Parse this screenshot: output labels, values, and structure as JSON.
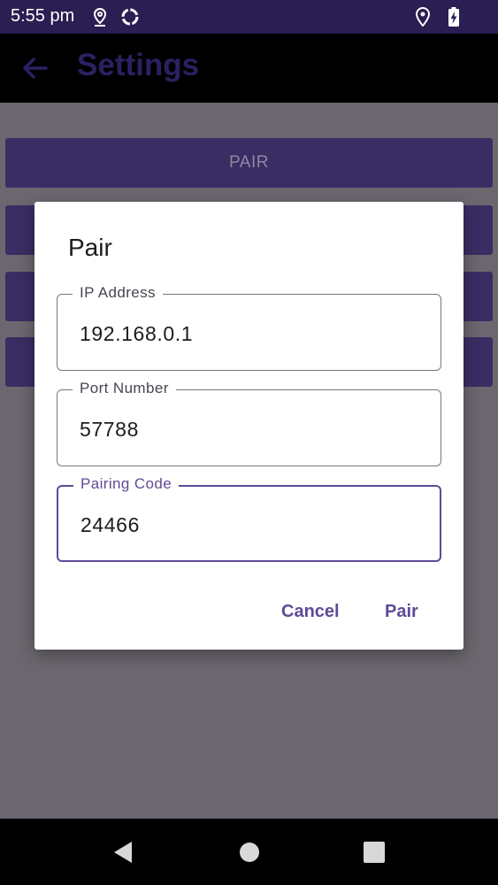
{
  "status_bar": {
    "time": "5:55 pm",
    "icons": [
      "location-outline-icon",
      "sync-circle-icon",
      "location-icon",
      "battery-charging-icon"
    ]
  },
  "app_bar": {
    "title": "Settings",
    "back_icon": "back-arrow-icon"
  },
  "background_buttons": [
    {
      "label": "PAIR"
    },
    {
      "label": ""
    },
    {
      "label": ""
    },
    {
      "label": ""
    }
  ],
  "dialog": {
    "title": "Pair",
    "fields": [
      {
        "label": "IP Address",
        "value": "192.168.0.1"
      },
      {
        "label": "Port Number",
        "value": "57788"
      },
      {
        "label": "Pairing Code",
        "value": "24466"
      }
    ],
    "cancel_label": "Cancel",
    "pair_label": "Pair"
  },
  "colors": {
    "accent": "#5e4a96",
    "status_bar": "#2b1e52",
    "button": "#3a2d63"
  }
}
